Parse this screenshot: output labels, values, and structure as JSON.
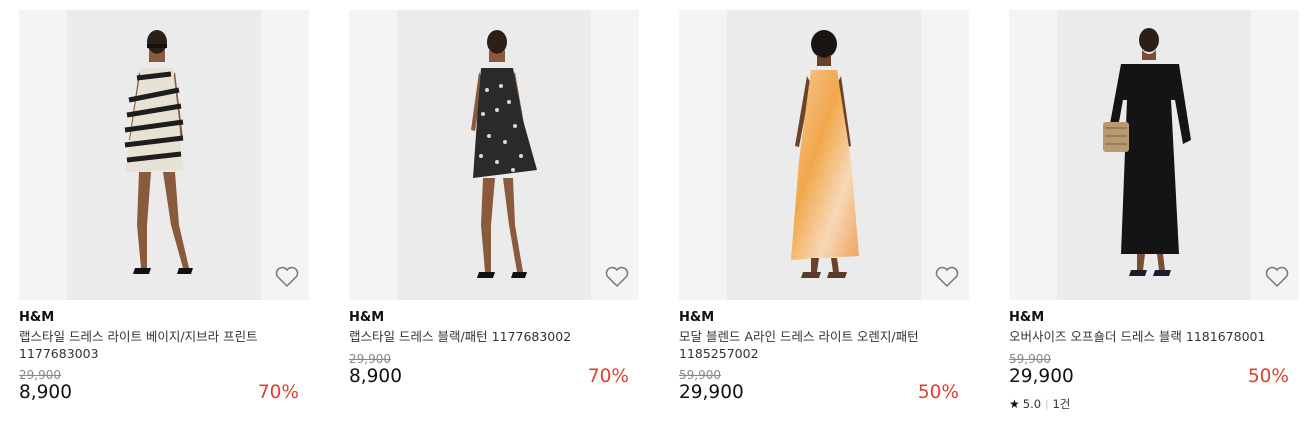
{
  "colors": {
    "discount": "#e03e2d",
    "image_bg": "#f4f4f4",
    "image_inner_bg": "#ebebeb"
  },
  "products": [
    {
      "brand": "H&M",
      "name": "랩스타일 드레스 라이트 베이지/지브라 프린트 1177683003",
      "original_price": "29,900",
      "price": "8,900",
      "discount": "70%",
      "image_icon": "zebra-print-dress-image",
      "wishlist_icon": "heart-outline-icon"
    },
    {
      "brand": "H&M",
      "name": "랩스타일 드레스 블랙/패턴 1177683002",
      "original_price": "29,900",
      "price": "8,900",
      "discount": "70%",
      "image_icon": "black-pattern-dress-image",
      "wishlist_icon": "heart-outline-icon"
    },
    {
      "brand": "H&M",
      "name": "모달 블렌드 A라인 드레스 라이트 오렌지/패턴 1185257002",
      "original_price": "59,900",
      "price": "29,900",
      "discount": "50%",
      "image_icon": "orange-maxi-dress-image",
      "wishlist_icon": "heart-outline-icon"
    },
    {
      "brand": "H&M",
      "name": "오버사이즈 오프숄더 드레스 블랙 1181678001",
      "original_price": "59,900",
      "price": "29,900",
      "discount": "50%",
      "rating": "5.0",
      "review_count": "1건",
      "image_icon": "black-offshoulder-dress-image",
      "wishlist_icon": "heart-outline-icon"
    }
  ]
}
